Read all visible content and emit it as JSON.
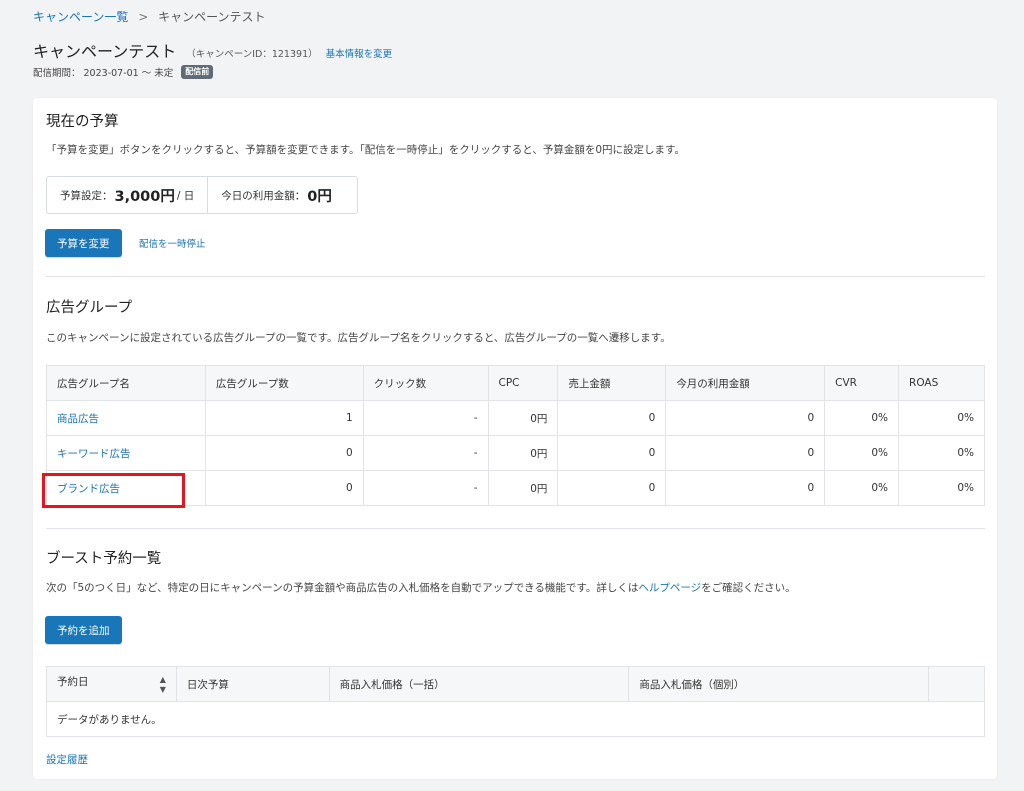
{
  "breadcrumb": {
    "parent": "キャンペーン一覧",
    "separator": ">",
    "current": "キャンペーンテスト"
  },
  "header": {
    "title": "キャンペーンテスト",
    "campaign_id": "（キャンペーンID：121391）",
    "edit_link": "基本情報を変更",
    "period_label": "配信期間：",
    "period_value": "2023-07-01 ～ 未定",
    "status_badge": "配信前"
  },
  "budget": {
    "title": "現在の予算",
    "description": "「予算を変更」ボタンをクリックすると、予算額を変更できます。「配信を一時停止」をクリックすると、予算金額を0円に設定します。",
    "setting_label": "予算設定：",
    "setting_value": "3,000円",
    "setting_unit": "/ 日",
    "today_label": "今日の利用金額：",
    "today_value": "0円",
    "change_button": "予算を変更",
    "pause_link": "配信を一時停止"
  },
  "ad_groups": {
    "title": "広告グループ",
    "description": "このキャンペーンに設定されている広告グループの一覧です。広告グループ名をクリックすると、広告グループの一覧へ遷移します。",
    "columns": [
      "広告グループ名",
      "広告グループ数",
      "クリック数",
      "CPC",
      "売上金額",
      "今月の利用金額",
      "CVR",
      "ROAS"
    ],
    "rows": [
      [
        "商品広告",
        "1",
        "-",
        "0円",
        "0",
        "0",
        "0%",
        "0%"
      ],
      [
        "キーワード広告",
        "0",
        "-",
        "0円",
        "0",
        "0",
        "0%",
        "0%"
      ],
      [
        "ブランド広告",
        "0",
        "-",
        "0円",
        "0",
        "0",
        "0%",
        "0%"
      ]
    ]
  },
  "boost": {
    "title": "ブースト予約一覧",
    "description_before": "次の「5のつく日」など、特定の日にキャンペーンの予算金額や商品広告の入札価格を自動でアップできる機能です。詳しくは",
    "help_link": "ヘルプページ",
    "description_after": "をご確認ください。",
    "add_button": "予約を追加",
    "columns": [
      "予約日",
      "日次予算",
      "商品入札価格（一括）",
      "商品入札価格（個別）",
      ""
    ],
    "empty_message": "データがありません。",
    "sort_icon": "sort-icon"
  },
  "footer": {
    "history_link": "設定履歴"
  },
  "colors": {
    "accent": "#1976b8",
    "link": "#1a73b8",
    "highlight": "#e8131c",
    "badge": "#5f6b78"
  }
}
